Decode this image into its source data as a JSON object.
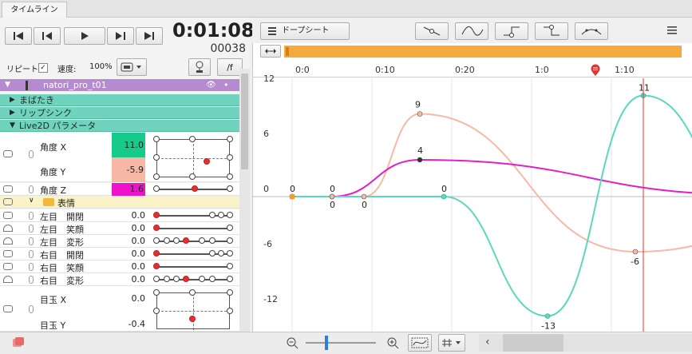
{
  "tab": {
    "label": "タイムライン"
  },
  "playback": {
    "timecode": "0:01:08",
    "frame": "00038",
    "buttons": [
      "first-frame",
      "prev-frame",
      "play",
      "next-frame",
      "last-frame"
    ]
  },
  "options": {
    "repeat_label": "リピート",
    "repeat_checked": "✓",
    "speed_label": "速度:",
    "speed_value": "100%",
    "fps_button": "/f"
  },
  "tree": {
    "model": "natori_pro_t01",
    "groups": [
      "まばたき",
      "リップシンク",
      "Live2D パラメータ"
    ],
    "subgroup": "表情",
    "params": [
      {
        "name": "角度 X",
        "value": "11.0"
      },
      {
        "name": "角度 Y",
        "value": "-5.9"
      },
      {
        "name": "角度 Z",
        "value": "1.6"
      },
      {
        "name": "左目　開閉",
        "value": "0.0"
      },
      {
        "name": "左目　笑顔",
        "value": "0.0"
      },
      {
        "name": "左目　変形",
        "value": "0.0"
      },
      {
        "name": "右目　開閉",
        "value": "0.0"
      },
      {
        "name": "右目　笑顔",
        "value": "0.0"
      },
      {
        "name": "右目　変形",
        "value": "0.0"
      },
      {
        "name": "目玉 X",
        "value": "0.0"
      },
      {
        "name": "目玉 Y",
        "value": "-0.4"
      }
    ]
  },
  "toolbar": {
    "dopesheet": "ドープシート",
    "curve_buttons": [
      "linear-curve-icon",
      "bezier-curve-icon",
      "step-curve-icon",
      "inverse-step-curve-icon",
      "smooth-curve-icon"
    ]
  },
  "ruler": {
    "labels": [
      "0:0",
      "0:10",
      "0:20",
      "1:0",
      "1:10"
    ]
  },
  "graph": {
    "y_labels": [
      "12",
      "6",
      "0",
      "-6",
      "-12"
    ],
    "colors": {
      "teal": "#5ed8bd",
      "magenta": "#e020c8",
      "pink": "#f7b9a8",
      "playhead": "#e53030",
      "range": "#f6a93c"
    },
    "series": [
      {
        "points": [
          [
            0,
            0
          ],
          [
            5,
            0
          ],
          [
            19,
            0
          ],
          [
            32,
            -13
          ],
          [
            44,
            11
          ],
          [
            58,
            -1
          ]
        ]
      },
      {
        "points": [
          [
            0,
            0
          ],
          [
            5,
            0
          ],
          [
            16,
            4
          ],
          [
            58,
            0.2
          ]
        ]
      },
      {
        "points": [
          [
            5,
            0
          ],
          [
            9,
            0
          ],
          [
            16,
            9
          ],
          [
            43,
            -6
          ],
          [
            58,
            -4.6
          ]
        ]
      }
    ],
    "point_labels": [
      {
        "text": "0",
        "x": 0,
        "y": 0
      },
      {
        "text": "0",
        "x": 5,
        "y": 0
      },
      {
        "text": "0",
        "x": 5,
        "y": 0
      },
      {
        "text": "0",
        "x": 9,
        "y": 0
      },
      {
        "text": "9",
        "x": 16,
        "y": 9
      },
      {
        "text": "4",
        "x": 16,
        "y": 4
      },
      {
        "text": "0",
        "x": 19,
        "y": 0
      },
      {
        "text": "-13",
        "x": 32,
        "y": -13
      },
      {
        "text": "-6",
        "x": 43,
        "y": -6
      },
      {
        "text": "11",
        "x": 44,
        "y": 11
      }
    ],
    "playhead_frame": 44
  }
}
